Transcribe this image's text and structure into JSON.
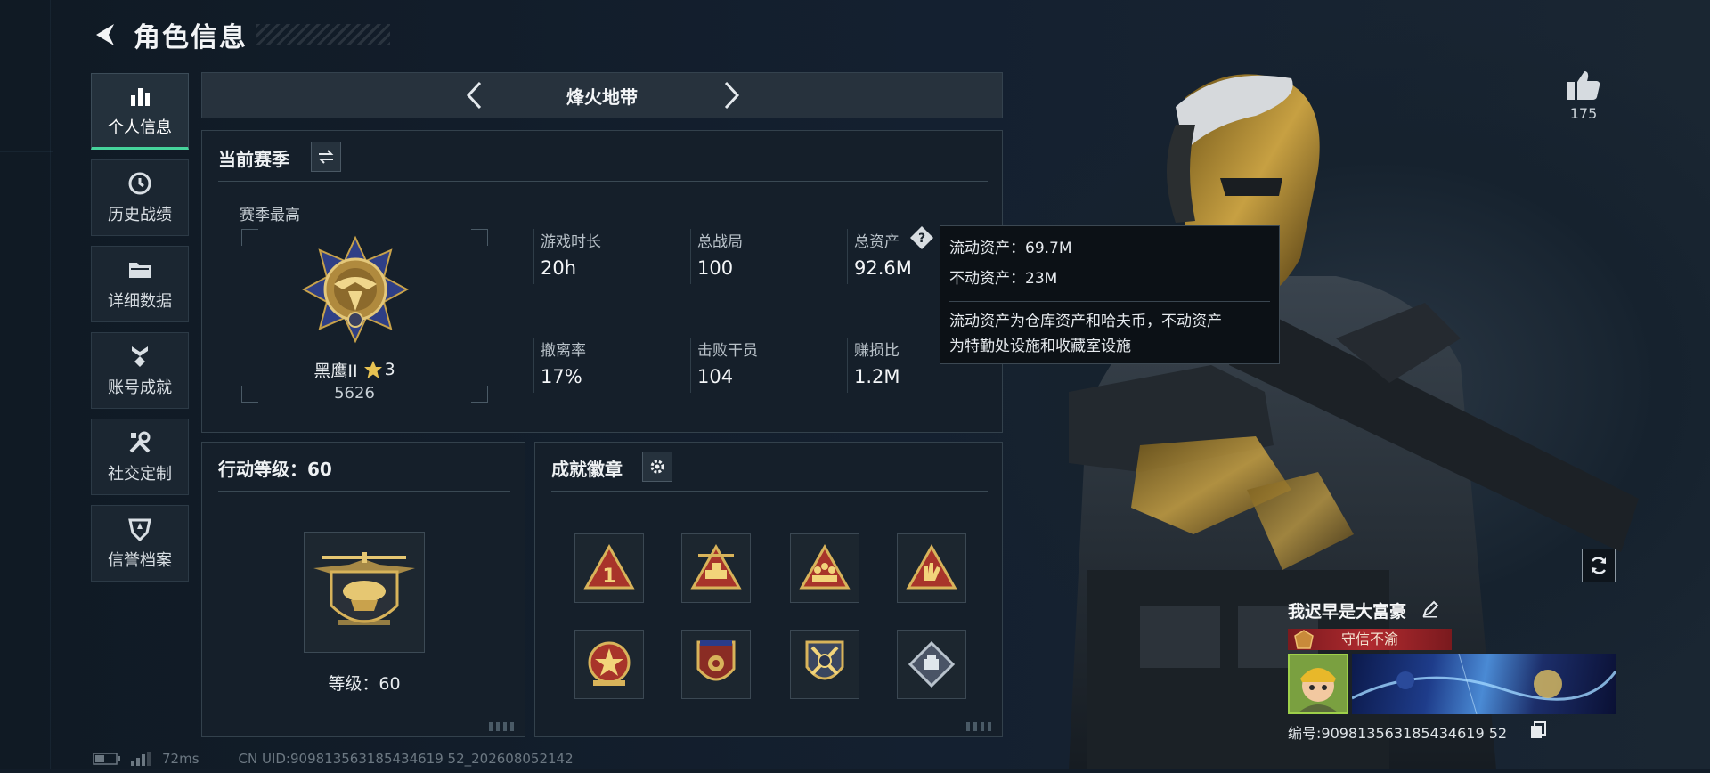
{
  "header": {
    "title": "角色信息"
  },
  "nav": [
    {
      "label": "个人信息",
      "icon": "bar-chart-icon",
      "active": true
    },
    {
      "label": "历史战绩",
      "icon": "clock-icon",
      "active": false
    },
    {
      "label": "详细数据",
      "icon": "folder-icon",
      "active": false
    },
    {
      "label": "账号成就",
      "icon": "medal-icon",
      "active": false
    },
    {
      "label": "社交定制",
      "icon": "wrench-icon",
      "active": false
    },
    {
      "label": "信誉档案",
      "icon": "shield-icon",
      "active": false
    }
  ],
  "mode": {
    "title": "烽火地带"
  },
  "season": {
    "title": "当前赛季",
    "best_label": "赛季最高",
    "rank_name": "黑鹰II",
    "rank_stars": "3",
    "rank_score": "5626",
    "stats": [
      {
        "label": "游戏时长",
        "value": "20h"
      },
      {
        "label": "总战局",
        "value": "100"
      },
      {
        "label": "总资产",
        "value": "92.6M"
      },
      {
        "label": "撤离率",
        "value": "17%"
      },
      {
        "label": "击败干员",
        "value": "104"
      },
      {
        "label": "赚损比",
        "value": "1.2M"
      }
    ]
  },
  "tooltip": {
    "liquid": "流动资产：69.7M",
    "fixed": "不动资产：23M",
    "desc_line1": "流动资产为仓库资产和哈夫币，不动资产",
    "desc_line2": "为特勤处设施和收藏室设施"
  },
  "action_level": {
    "title": "行动等级：60",
    "level_text": "等级：60"
  },
  "badges": {
    "title": "成就徽章",
    "items": [
      "triangle-1-badge",
      "tank-badge",
      "squad-badge",
      "hand-badge",
      "star-emblem-badge",
      "shield-badge",
      "crossed-badge",
      "diamond-badge"
    ]
  },
  "profile": {
    "likes": "175",
    "name": "我迟早是大富豪",
    "title": "守信不渝",
    "id_text": "编号:909813563185434619 52"
  },
  "footer": {
    "latency": "72ms",
    "uid": "CN UID:909813563185434619 52_202608052142"
  },
  "colors": {
    "accent": "#46d49c",
    "title_strip": "#b02a2f",
    "gold": "#c8a24a"
  }
}
